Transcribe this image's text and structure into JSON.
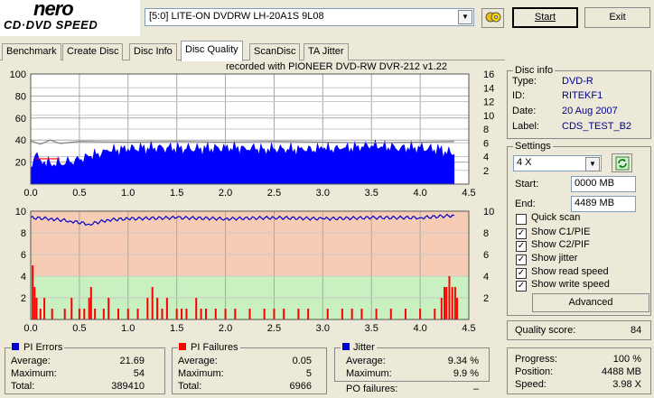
{
  "app": {
    "logo_text": "nero",
    "logo_sub": "CD·DVD SPEED",
    "drive": "[5:0]  LITE-ON DVDRW LH-20A1S 9L08",
    "start_label": "Start",
    "exit_label": "Exit"
  },
  "tabs": [
    "Benchmark",
    "Create Disc",
    "Disc Info",
    "Disc Quality",
    "ScanDisc",
    "TA Jitter"
  ],
  "active_tab": "Disc Quality",
  "recorded_with": "recorded with PIONEER DVD-RW  DVR-212  v1.22",
  "chart_data": [
    {
      "type": "area",
      "title": "",
      "x_ticks": [
        "0.0",
        "0.5",
        "1.0",
        "1.5",
        "2.0",
        "2.5",
        "3.0",
        "3.5",
        "4.0",
        "4.5"
      ],
      "xlim": [
        0,
        4.5
      ],
      "y_left_ticks": [
        "100",
        "80",
        "60",
        "40",
        "20"
      ],
      "ylim_left": [
        0,
        100
      ],
      "y_right_ticks": [
        "16",
        "14",
        "12",
        "10",
        "8",
        "6",
        "4",
        "2"
      ],
      "ylim_right": [
        0,
        16
      ],
      "grid": true,
      "series": [
        {
          "type": "area",
          "color": "#0000ff",
          "x": [
            0.0,
            0.05,
            0.1,
            0.2,
            0.3,
            0.4,
            0.5,
            0.6,
            0.8,
            1.0,
            1.2,
            1.4,
            1.6,
            1.8,
            2.0,
            2.2,
            2.4,
            2.6,
            2.8,
            3.0,
            3.2,
            3.4,
            3.5,
            3.6,
            3.8,
            4.0,
            4.2,
            4.35
          ],
          "y": [
            15,
            27,
            22,
            19,
            19,
            20,
            22,
            25,
            30,
            32,
            33,
            33,
            32,
            32,
            33,
            33,
            32,
            32,
            31,
            32,
            32,
            34,
            35,
            34,
            33,
            33,
            31,
            27
          ]
        },
        {
          "type": "line",
          "color": "#ff0000",
          "x": [
            0.05,
            0.3
          ],
          "y": [
            23,
            23
          ]
        },
        {
          "type": "line",
          "color": "#808080",
          "x": [
            0.0,
            0.1,
            0.2,
            0.3,
            0.5,
            1.0,
            1.5,
            2.0,
            2.5,
            3.0,
            3.5,
            4.0,
            4.35
          ],
          "y": [
            6.3,
            5.8,
            6.4,
            5.9,
            6.2,
            6.1,
            6.2,
            6.1,
            6.2,
            6.1,
            6.0,
            6.1,
            6.2
          ]
        }
      ]
    },
    {
      "type": "bar",
      "title": "",
      "x_ticks": [
        "0.0",
        "0.5",
        "1.0",
        "1.5",
        "2.0",
        "2.5",
        "3.0",
        "3.5",
        "4.0",
        "4.5"
      ],
      "xlim": [
        0,
        4.5
      ],
      "y_left_ticks": [
        "10",
        "8",
        "6",
        "4",
        "2"
      ],
      "ylim_left": [
        0,
        10
      ],
      "y_right_ticks": [
        "10",
        "8",
        "6",
        "4",
        "2"
      ],
      "ylim_right": [
        0,
        10
      ],
      "grid": true,
      "series": [
        {
          "type": "bar",
          "color": "#ff0000",
          "x": [
            0.02,
            0.04,
            0.06,
            0.1,
            0.14,
            0.22,
            0.35,
            0.42,
            0.5,
            0.55,
            0.6,
            0.62,
            0.66,
            0.75,
            0.8,
            0.9,
            1.0,
            1.1,
            1.2,
            1.25,
            1.3,
            1.35,
            1.4,
            1.5,
            1.55,
            1.6,
            1.7,
            1.75,
            1.8,
            1.9,
            2.0,
            2.1,
            2.25,
            2.4,
            2.5,
            2.6,
            2.75,
            2.85,
            3.05,
            3.2,
            3.3,
            3.4,
            3.55,
            3.7,
            3.85,
            4.0,
            4.15,
            4.22,
            4.25,
            4.27,
            4.3,
            4.33,
            4.36,
            4.38
          ],
          "y": [
            5,
            3,
            2,
            1,
            2,
            1,
            1,
            2,
            1,
            1,
            2,
            3,
            1,
            1,
            2,
            1,
            1,
            1,
            2,
            3,
            2,
            1,
            2,
            1,
            1,
            1,
            2,
            1,
            1,
            1,
            1,
            1,
            1,
            1,
            1,
            1,
            1,
            1,
            1,
            1,
            1,
            1,
            1,
            1,
            1,
            1,
            1,
            2,
            3,
            3,
            4,
            3,
            3,
            2
          ]
        },
        {
          "type": "line",
          "color": "#0000cd",
          "x": [
            0.0,
            0.2,
            0.4,
            0.6,
            0.8,
            1.0,
            1.5,
            2.0,
            2.5,
            3.0,
            3.5,
            4.0,
            4.35
          ],
          "y": [
            9.4,
            9.3,
            9.1,
            8.8,
            9.2,
            9.3,
            9.4,
            9.3,
            9.4,
            9.3,
            9.4,
            9.4,
            9.6
          ]
        }
      ]
    }
  ],
  "disc_info": {
    "title": "Disc info",
    "type_label": "Type:",
    "type": "DVD-R",
    "id_label": "ID:",
    "id": "RITEKF1",
    "date_label": "Date:",
    "date": "20 Aug 2007",
    "label_label": "Label:",
    "label": "CDS_TEST_B2"
  },
  "settings": {
    "title": "Settings",
    "speed": "4 X",
    "start_label": "Start:",
    "start": "0000 MB",
    "end_label": "End:",
    "end": "4489 MB",
    "checks": [
      {
        "label": "Quick scan",
        "checked": false
      },
      {
        "label": "Show C1/PIE",
        "checked": true
      },
      {
        "label": "Show C2/PIF",
        "checked": true
      },
      {
        "label": "Show jitter",
        "checked": true
      },
      {
        "label": "Show read speed",
        "checked": true
      },
      {
        "label": "Show write speed",
        "checked": true
      }
    ],
    "advanced_label": "Advanced"
  },
  "quality": {
    "label": "Quality score:",
    "value": "84"
  },
  "progress": {
    "progress_label": "Progress:",
    "progress": "100 %",
    "position_label": "Position:",
    "position": "4488 MB",
    "speed_label": "Speed:",
    "speed": "3.98 X"
  },
  "pi_errors": {
    "title": "PI Errors",
    "color": "#0000cd",
    "avg_label": "Average:",
    "avg": "21.69",
    "max_label": "Maximum:",
    "max": "54",
    "total_label": "Total:",
    "total": "389410"
  },
  "pi_failures": {
    "title": "PI Failures",
    "color": "#ff0000",
    "avg_label": "Average:",
    "avg": "0.05",
    "max_label": "Maximum:",
    "max": "5",
    "total_label": "Total:",
    "total": "6966"
  },
  "jitter": {
    "title": "Jitter",
    "color": "#0000cd",
    "avg_label": "Average:",
    "avg": "9.34 %",
    "max_label": "Maximum:",
    "max": "9.9 %",
    "po_label": "PO failures:",
    "po": "–"
  }
}
